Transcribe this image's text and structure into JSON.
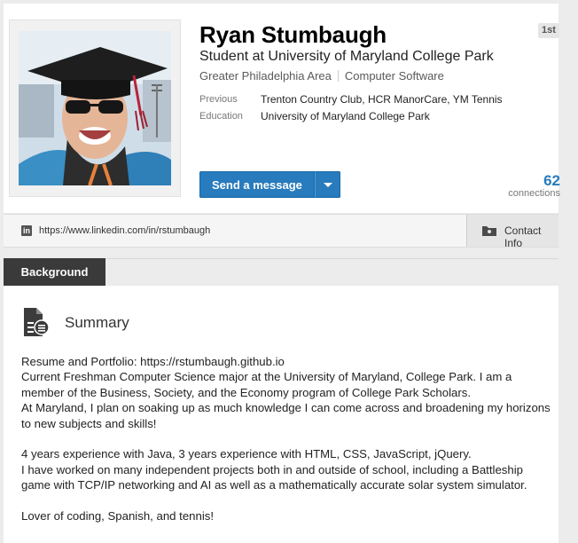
{
  "profile": {
    "name": "Ryan Stumbaugh",
    "headline": "Student at University of Maryland College Park",
    "location": "Greater Philadelphia Area",
    "industry": "Computer Software",
    "degree": "1st",
    "previous_label": "Previous",
    "previous_value": "Trenton Country Club, HCR ManorCare, YM Tennis",
    "education_label": "Education",
    "education_value": "University of Maryland College Park"
  },
  "actions": {
    "send_message_label": "Send a message"
  },
  "connections": {
    "count": "62",
    "label": "connections"
  },
  "url_bar": {
    "icon_text": "in",
    "url": "https://www.linkedin.com/in/rstumbaugh",
    "contact_label": "Contact Info"
  },
  "background": {
    "tab_label": "Background",
    "summary_heading": "Summary",
    "summary_lines": [
      "Resume and Portfolio: https://rstumbaugh.github.io",
      "Current Freshman Computer Science major at the University of Maryland, College Park. I am a member of the Business, Society, and the Economy program of College Park Scholars.",
      "At Maryland, I plan on soaking up as much knowledge I can come across and broadening my horizons to new subjects and skills!",
      "",
      "4 years experience with Java, 3 years experience with HTML, CSS, JavaScript, jQuery.",
      "I have worked on many independent projects both in and outside of school, including a Battleship game with TCP/IP networking and AI as well as a mathematically accurate solar system simulator.",
      "",
      "Lover of coding, Spanish, and tennis!"
    ]
  },
  "colors": {
    "accent": "#287bbc",
    "tab_dark": "#3a3a3a",
    "page_bg": "#ececec"
  },
  "icons": {
    "linkedin": "linkedin-icon",
    "contact": "folder-card-icon",
    "summary": "document-icon",
    "dropdown": "chevron-down-icon"
  }
}
